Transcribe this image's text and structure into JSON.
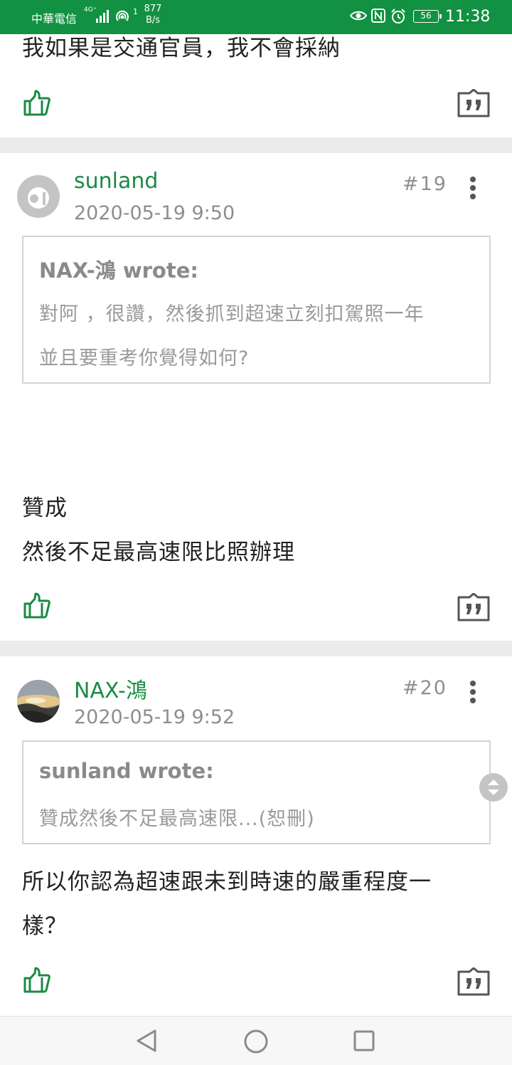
{
  "status_bar": {
    "carrier": "中華電信",
    "network": "4G⁺",
    "signal_suffix": "1",
    "speed_value": "877",
    "speed_unit": "B/s",
    "battery": "56",
    "time": "11:38",
    "color": "#119141"
  },
  "posts": [
    {
      "body_lines": [
        "我如果是交通官員，我不會採納"
      ]
    },
    {
      "username": "sunland",
      "date": "2020-05-19 9:50",
      "floor": "#19",
      "quote": {
        "author": "NAX-鴻  wrote:",
        "lines": [
          "對阿 ，很讚，然後抓到超速立刻扣駕照一年",
          "並且要重考你覺得如何?"
        ]
      },
      "body_lines": [
        "贊成",
        "然後不足最高速限比照辦理"
      ]
    },
    {
      "username": "NAX-鴻",
      "date": "2020-05-19 9:52",
      "floor": "#20",
      "quote": {
        "author": "sunland  wrote:",
        "lines": [
          "贊成然後不足最高速限...(恕刪)"
        ]
      },
      "body_lines": [
        "所以你認為超速跟未到時速的嚴重程度一",
        "樣？"
      ]
    }
  ],
  "icons": {
    "like": "thumbs-up-icon",
    "quote": "quote-reply-icon",
    "more": "more-vertical-icon",
    "nav_back": "back-triangle-icon",
    "nav_home": "home-circle-icon",
    "nav_recent": "recent-apps-square-icon"
  },
  "colors": {
    "accent_green": "#1b8a44",
    "meta_gray": "#8e8e8e",
    "divider": "#ebebeb"
  }
}
